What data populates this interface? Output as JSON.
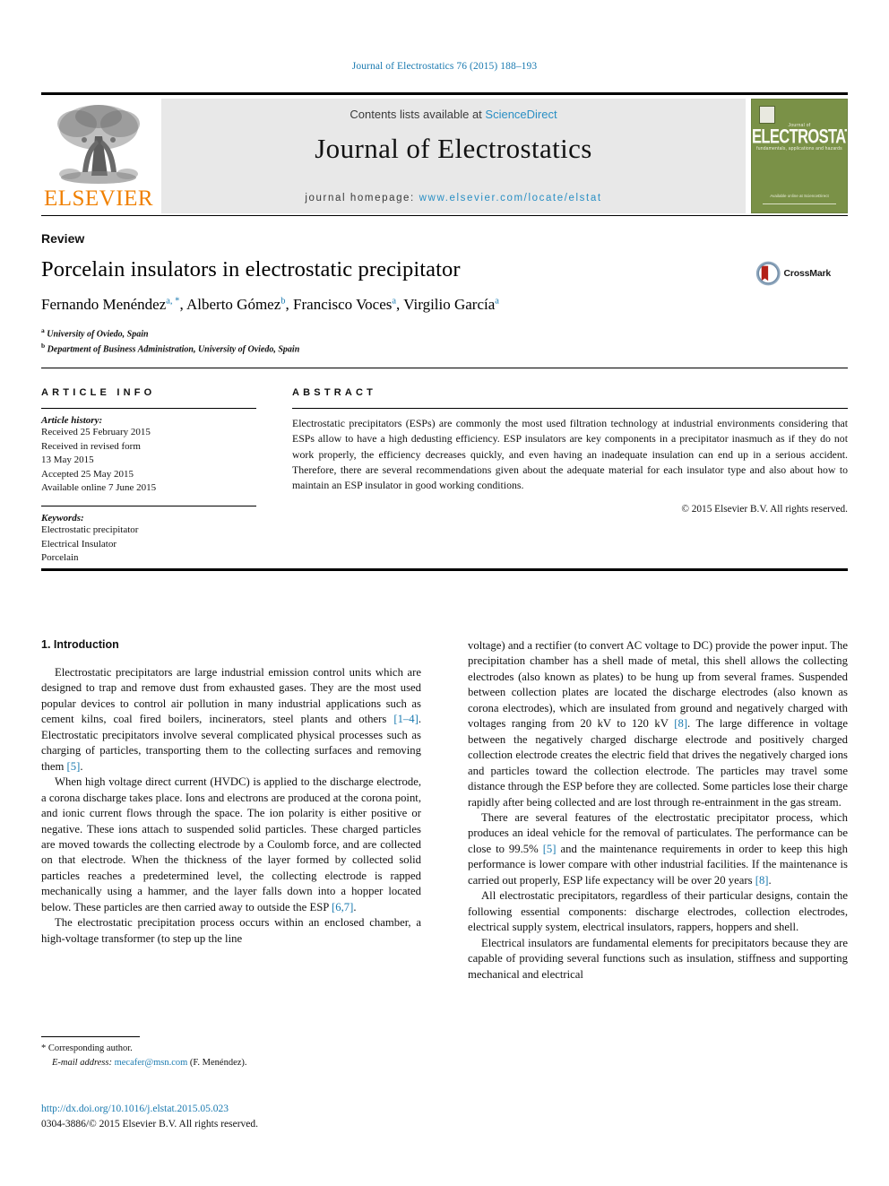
{
  "running_head": "Journal of Electrostatics 76 (2015) 188–193",
  "masthead": {
    "publisher_name": "ELSEVIER",
    "contents_prefix": "Contents lists available at ",
    "contents_link": "ScienceDirect",
    "journal_name": "Journal of Electrostatics",
    "homepage_prefix": "journal homepage: ",
    "homepage_url": "www.elsevier.com/locate/elstat",
    "cover": {
      "pretitle": "Journal of",
      "title": "ELECTROSTATICS",
      "subtitle": "fundamentals, applications and hazards",
      "footer": "Available online at\nScienceDirect"
    }
  },
  "article": {
    "type_label": "Review",
    "title": "Porcelain insulators in electrostatic precipitator",
    "authors": [
      {
        "name": "Fernando Menéndez",
        "markers": "a, *"
      },
      {
        "name": "Alberto Gómez",
        "markers": "b"
      },
      {
        "name": "Francisco Voces",
        "markers": "a"
      },
      {
        "name": "Virgilio García",
        "markers": "a"
      }
    ],
    "affiliations": [
      {
        "marker": "a",
        "text": "University of Oviedo, Spain"
      },
      {
        "marker": "b",
        "text": "Department of Business Administration, University of Oviedo, Spain"
      }
    ],
    "crossmark_label": "CrossMark"
  },
  "article_info": {
    "heading": "ARTICLE INFO",
    "history_label": "Article history:",
    "history": [
      "Received 25 February 2015",
      "Received in revised form",
      "13 May 2015",
      "Accepted 25 May 2015",
      "Available online 7 June 2015"
    ],
    "keywords_label": "Keywords:",
    "keywords": [
      "Electrostatic precipitator",
      "Electrical Insulator",
      "Porcelain"
    ]
  },
  "abstract": {
    "heading": "ABSTRACT",
    "text": "Electrostatic precipitators (ESPs) are commonly the most used filtration technology at industrial environments considering that ESPs allow to have a high dedusting efficiency. ESP insulators are key components in a precipitator inasmuch as if they do not work properly, the efficiency decreases quickly, and even having an inadequate insulation can end up in a serious accident. Therefore, there are several recommendations given about the adequate material for each insulator type and also about how to maintain an ESP insulator in good working conditions.",
    "copyright": "© 2015 Elsevier B.V. All rights reserved."
  },
  "body": {
    "section_number_title": "1. Introduction",
    "left_paragraphs": [
      "Electrostatic precipitators are large industrial emission control units which are designed to trap and remove dust from exhausted gases. They are the most used popular devices to control air pollution in many industrial applications such as cement kilns, coal fired boilers, incinerators, steel plants and others [1–4]. Electrostatic precipitators involve several complicated physical processes such as charging of particles, transporting them to the collecting surfaces and removing them [5].",
      "When high voltage direct current (HVDC) is applied to the discharge electrode, a corona discharge takes place. Ions and electrons are produced at the corona point, and ionic current flows through the space. The ion polarity is either positive or negative. These ions attach to suspended solid particles. These charged particles are moved towards the collecting electrode by a Coulomb force, and are collected on that electrode. When the thickness of the layer formed by collected solid particles reaches a predetermined level, the collecting electrode is rapped mechanically using a hammer, and the layer falls down into a hopper located below. These particles are then carried away to outside the ESP [6,7].",
      "The electrostatic precipitation process occurs within an enclosed chamber, a high-voltage transformer (to step up the line"
    ],
    "right_paragraphs": [
      "voltage) and a rectifier (to convert AC voltage to DC) provide the power input. The precipitation chamber has a shell made of metal, this shell allows the collecting electrodes (also known as plates) to be hung up from several frames. Suspended between collection plates are located the discharge electrodes (also known as corona electrodes), which are insulated from ground and negatively charged with voltages ranging from 20 kV to 120 kV [8]. The large difference in voltage between the negatively charged discharge electrode and positively charged collection electrode creates the electric field that drives the negatively charged ions and particles toward the collection electrode. The particles may travel some distance through the ESP before they are collected. Some particles lose their charge rapidly after being collected and are lost through re-entrainment in the gas stream.",
      "There are several features of the electrostatic precipitator process, which produces an ideal vehicle for the removal of particulates. The performance can be close to 99.5% [5] and the maintenance requirements in order to keep this high performance is lower compare with other industrial facilities. If the maintenance is carried out properly, ESP life expectancy will be over 20 years [8].",
      "All electrostatic precipitators, regardless of their particular designs, contain the following essential components: discharge electrodes, collection electrodes, electrical supply system, electrical insulators, rappers, hoppers and shell.",
      "Electrical insulators are fundamental elements for precipitators because they are capable of providing several functions such as insulation, stiffness and supporting mechanical and electrical"
    ]
  },
  "footnote": {
    "corresponding_author": "* Corresponding author.",
    "email_label": "E-mail address:",
    "email": "mecafer@msn.com",
    "email_suffix": "(F. Menéndez)."
  },
  "footer": {
    "doi": "http://dx.doi.org/10.1016/j.elstat.2015.05.023",
    "issn_line": "0304-3886/© 2015 Elsevier B.V. All rights reserved."
  },
  "colors": {
    "link_blue": "#1a7ab0",
    "sciencedirect_blue": "#2a8fc4",
    "elsevier_orange": "#F08000",
    "cover_green": "#7a9147"
  }
}
